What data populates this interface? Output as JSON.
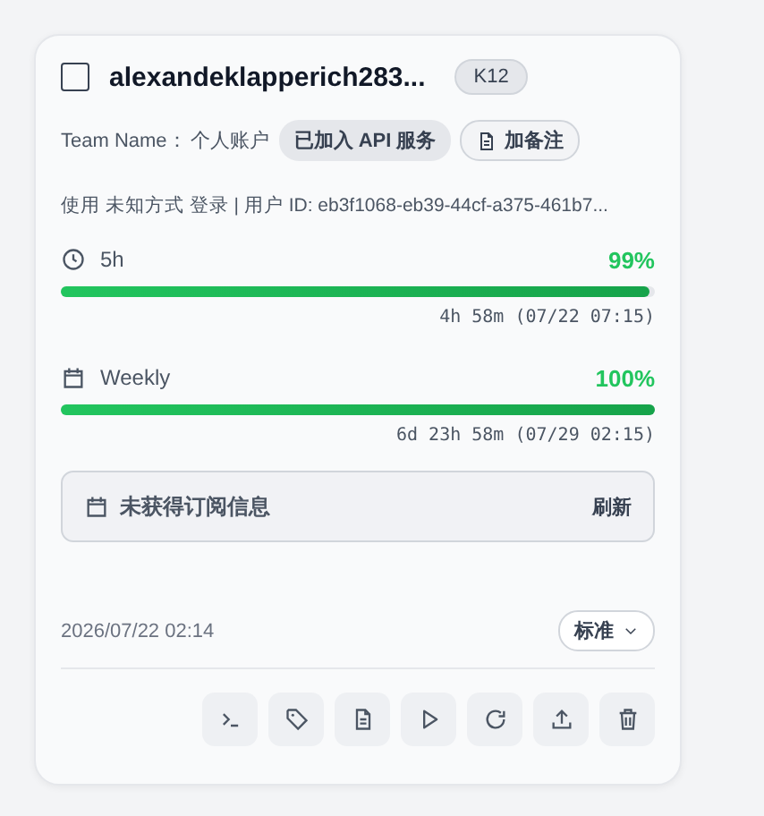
{
  "account": {
    "checked": false,
    "email": "alexandeklapperich283...",
    "plan": "K12"
  },
  "team": {
    "label": "Team Name：",
    "value": "个人账户",
    "api_badge": "已加入 API 服务",
    "note_button": "加备注"
  },
  "login_info": "使用 未知方式 登录 | 用户 ID: eb3f1068-eb39-44cf-a375-461b7...",
  "usage": [
    {
      "kind": "clock",
      "label": "5h",
      "percent": "99%",
      "level": 0.99,
      "reset": "4h 58m (07/22 07:15)"
    },
    {
      "kind": "calendar",
      "label": "Weekly",
      "percent": "100%",
      "level": 1.0,
      "reset": "6d 23h 58m (07/29 02:15)"
    }
  ],
  "subscription": {
    "message": "未获得订阅信息",
    "refresh": "刷新"
  },
  "date": "2026/07/22 02:14",
  "mode": "标准"
}
